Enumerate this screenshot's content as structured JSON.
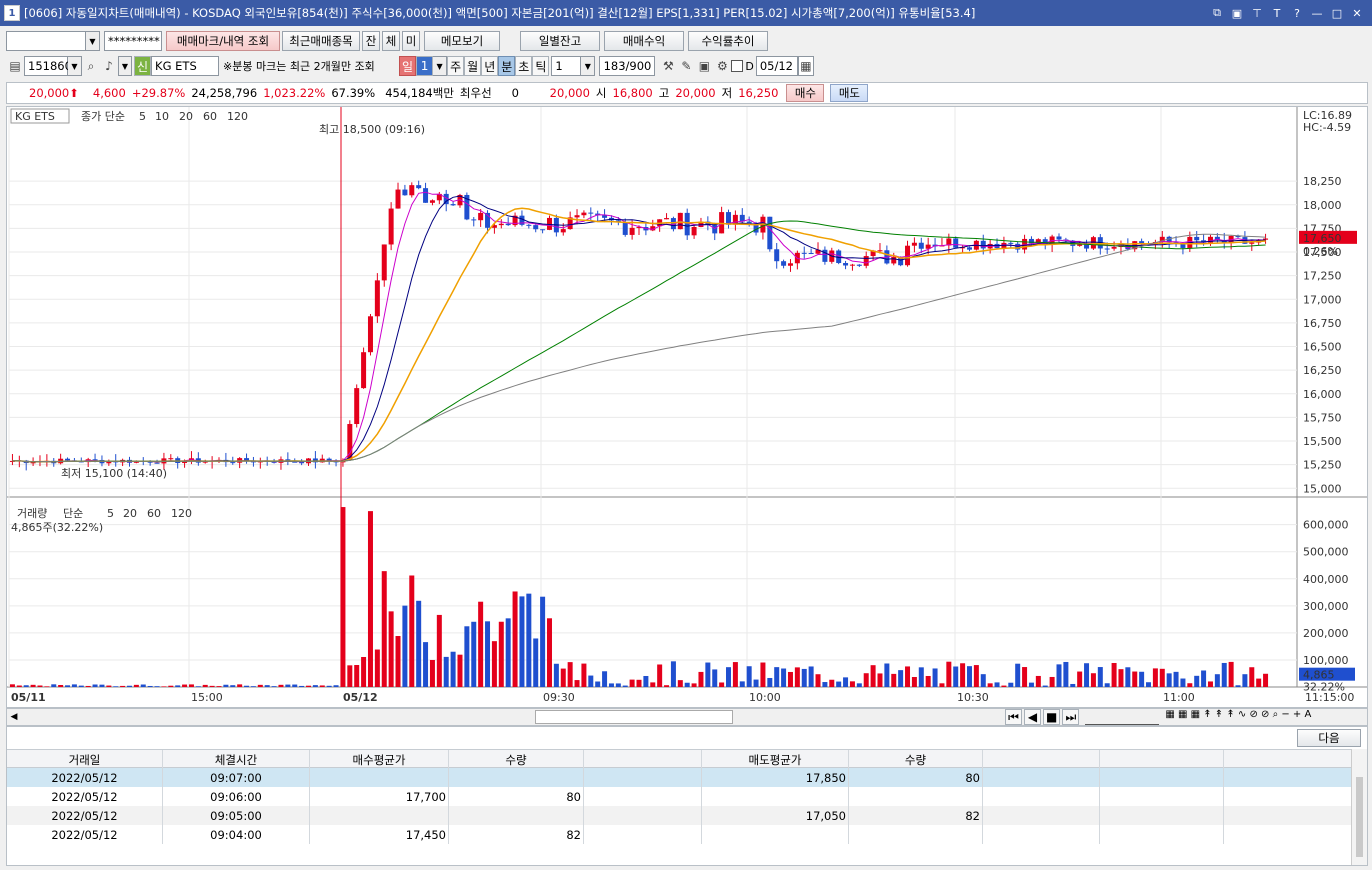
{
  "title": {
    "win_number": "1",
    "text": "[0606] 자동일지차트(매매내역) - KOSDAQ 외국인보유[854(천)] 주식수[36,000(천)] 액면[500] 자본금[201(억)] 결산[12월] EPS[1,331] PER[15.02] 시가총액[7,200(억)] 유통비율[53.4]"
  },
  "toolbar1": {
    "account_value": "",
    "password_mask": "*********",
    "btn_mark": "매매마크/내역 조회",
    "btn_recent": "최근매매종목",
    "btn_jan": "잔",
    "btn_che": "체",
    "btn_mi": "미",
    "btn_memo": "메모보기",
    "btn_daily": "일별잔고",
    "btn_profit": "매매수익",
    "btn_return": "수익률추이"
  },
  "toolbar2": {
    "code": "151860",
    "credit_badge": "신",
    "stock_name": "KG ETS",
    "note": "※분봉 마크는 최근 2개월만 조회",
    "period_il": "일",
    "period_num": "1",
    "period_ju": "주",
    "period_wol": "월",
    "period_nyeon": "년",
    "period_bun": "분",
    "period_cho": "초",
    "period_tik": "틱",
    "interval": "1",
    "count": "183/900",
    "d_label": "D",
    "date": "05/12"
  },
  "quote": {
    "price": "20,000",
    "change": "4,600",
    "pct": "+29.87%",
    "volume": "24,258,796",
    "vol_pct": "1,023.22%",
    "ratio": "67.39%",
    "amount": "454,184백만",
    "best_label": "최우선",
    "best_qty": "0",
    "best_price": "20,000",
    "open_label": "시",
    "open": "16,800",
    "high_label": "고",
    "high": "20,000",
    "low_label": "저",
    "low": "16,250",
    "buy": "매수",
    "sell": "매도"
  },
  "chart_data": [
    {
      "type": "candlestick",
      "title": "KG ETS",
      "ma_label": "종가 단순",
      "ma_periods": [
        "5",
        "10",
        "20",
        "60",
        "120"
      ],
      "ma_colors": [
        "#cc00cc",
        "#000080",
        "#f0a000",
        "#008000",
        "#808080"
      ],
      "annotations": {
        "high": "최고 18,500 (09:16)",
        "low": "최저 15,100 (14:40)",
        "lc": "LC:16.89",
        "hc": "HC:-4.59",
        "last_price": "17,650",
        "last_pct": "0.26%"
      },
      "yticks": [
        "18,250",
        "18,000",
        "17,750",
        "17,500",
        "17,250",
        "17,000",
        "16,750",
        "16,500",
        "16,250",
        "16,000",
        "15,750",
        "15,500",
        "15,250",
        "15,000"
      ],
      "ylim": [
        14950,
        18950
      ],
      "xticks": [
        "05/11",
        "15:00",
        "05/12",
        "09:30",
        "10:00",
        "10:30",
        "11:00",
        "11:15:00"
      ]
    },
    {
      "type": "bar",
      "title": "거래량",
      "ma_label": "단순",
      "ma_periods": [
        "5",
        "20",
        "60",
        "120"
      ],
      "current": "4,865주(32.22%)",
      "last_label": "4,865",
      "last_pct": "32.22%",
      "yticks": [
        "600,000",
        "500,000",
        "400,000",
        "300,000",
        "200,000",
        "100,000"
      ],
      "ylim": [
        0,
        680000
      ]
    }
  ],
  "table": {
    "next_btn": "다음",
    "headers": [
      "거래일",
      "체결시간",
      "매수평균가",
      "수량",
      "",
      "매도평균가",
      "수량",
      "",
      "",
      ""
    ],
    "rows": [
      [
        "2022/05/12",
        "09:07:00",
        "",
        "",
        "",
        "17,850",
        "80",
        "",
        "",
        ""
      ],
      [
        "2022/05/12",
        "09:06:00",
        "17,700",
        "80",
        "",
        "",
        "",
        "",
        "",
        ""
      ],
      [
        "2022/05/12",
        "09:05:00",
        "",
        "",
        "",
        "17,050",
        "82",
        "",
        "",
        ""
      ],
      [
        "2022/05/12",
        "09:04:00",
        "17,450",
        "82",
        "",
        "",
        "",
        "",
        "",
        ""
      ]
    ]
  }
}
